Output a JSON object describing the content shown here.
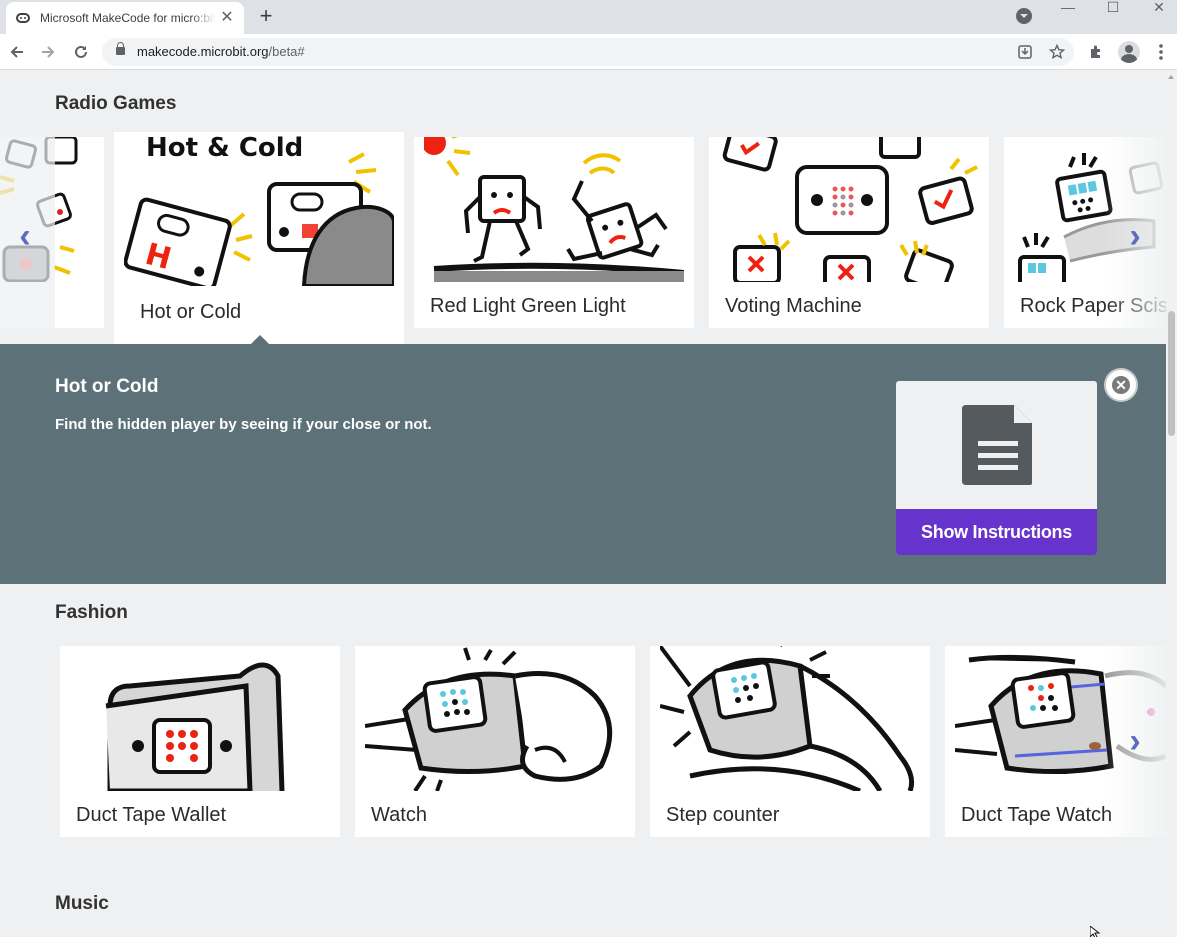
{
  "browser": {
    "tab_title": "Microsoft MakeCode for micro:bit",
    "tab_close": "✕",
    "new_tab": "+",
    "url_host": "makecode.microbit.org",
    "url_path": "/beta#",
    "window_min": "—",
    "window_max": "☐",
    "window_close": "✕"
  },
  "sections": {
    "radio_games": {
      "title": "Radio Games",
      "cards": [
        {
          "label": "Hot or Cold"
        },
        {
          "label": "Red Light Green Light"
        },
        {
          "label": "Voting Machine"
        },
        {
          "label": "Rock Paper Scissors"
        }
      ],
      "prev_arrow": "‹",
      "next_arrow": "›"
    },
    "fashion": {
      "title": "Fashion",
      "cards": [
        {
          "label": "Duct Tape Wallet"
        },
        {
          "label": "Watch"
        },
        {
          "label": "Step counter"
        },
        {
          "label": "Duct Tape Watch"
        }
      ],
      "next_arrow": "›"
    },
    "music": {
      "title": "Music"
    }
  },
  "detail": {
    "title": "Hot or Cold",
    "description": "Find the hidden player by seeing if your close or not.",
    "button_label": "Show Instructions",
    "close_symbol": "✕",
    "button_color": "#6633cc",
    "panel_color": "#5d7278"
  }
}
